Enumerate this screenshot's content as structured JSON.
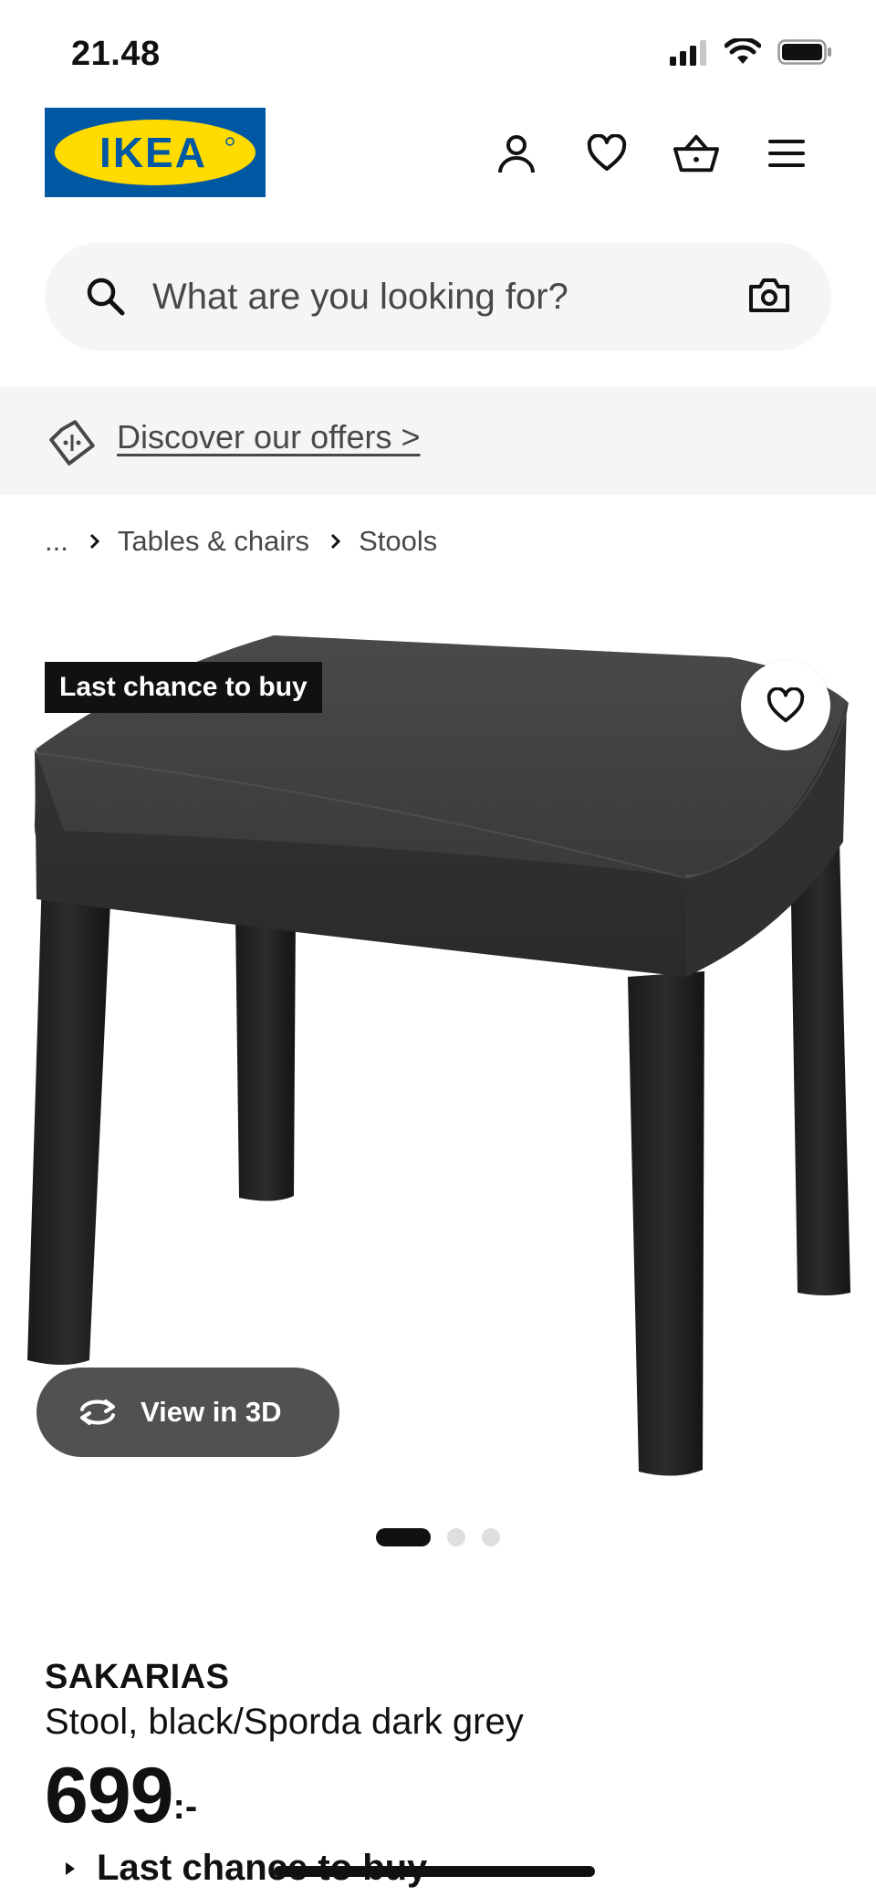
{
  "status_bar": {
    "time": "21.48",
    "icons": [
      "cellular-signal-icon",
      "wifi-icon",
      "battery-icon"
    ]
  },
  "header": {
    "logo_text": "IKEA",
    "icons": [
      "profile-icon",
      "wishlist-heart-icon",
      "shopping-bag-icon",
      "menu-icon"
    ]
  },
  "search": {
    "placeholder": "What are you looking for?",
    "value": ""
  },
  "offers": {
    "label": "Discover our offers >"
  },
  "breadcrumb": {
    "ellipsis": "...",
    "items": [
      "Tables & chairs",
      "Stools"
    ]
  },
  "product_media": {
    "badge": "Last chance to buy",
    "view_3d_label": "View in 3D",
    "slides_total": 3,
    "active_slide": 1
  },
  "product": {
    "name": "SAKARIAS",
    "description": "Stool, black/Sporda dark grey",
    "price_integer": "699",
    "price_suffix": ":-",
    "availability": "Last chance to buy"
  },
  "colors": {
    "ikea_blue": "#0058a3",
    "ikea_yellow": "#ffdb00",
    "text": "#111111",
    "muted_text": "#484848",
    "light_bg": "#f5f5f5"
  }
}
